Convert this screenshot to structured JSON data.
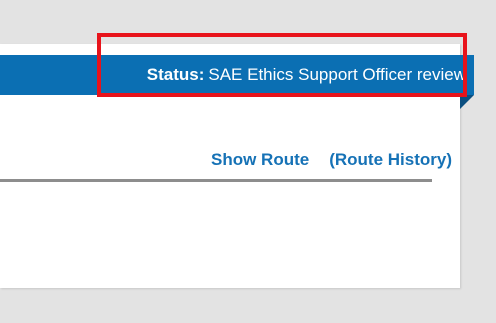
{
  "status": {
    "label": "Status",
    "separator": ":",
    "value": "SAE Ethics Support Officer review"
  },
  "route": {
    "show_route": "Show Route",
    "route_history": "(Route History)"
  },
  "colors": {
    "status_bar": "#0b6fb3",
    "link": "#1672b6",
    "highlight": "#e8131b",
    "background": "#e3e3e3"
  }
}
